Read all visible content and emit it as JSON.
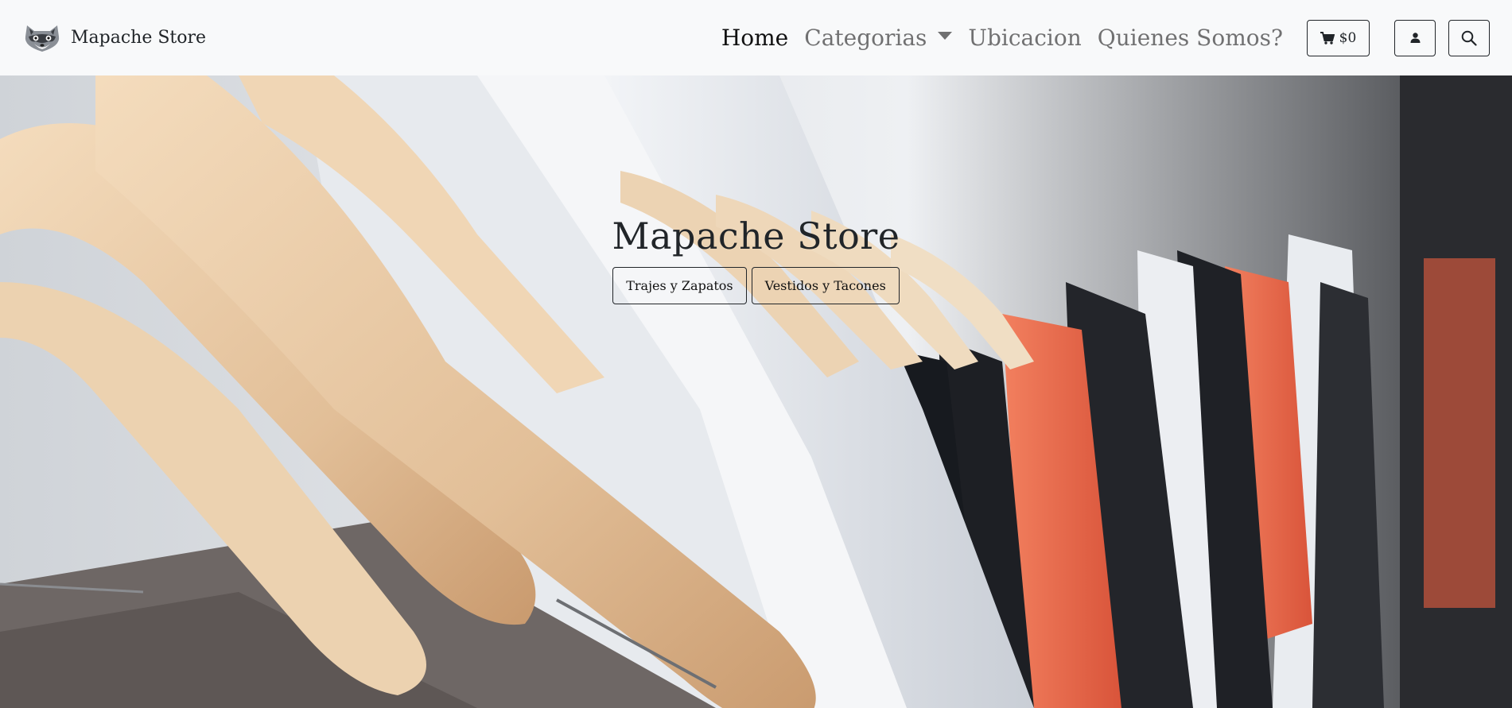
{
  "brand": {
    "name": "Mapache Store",
    "logo_icon": "raccoon-icon"
  },
  "nav": {
    "home": "Home",
    "categories": "Categorias",
    "location": "Ubicacion",
    "about": "Quienes Somos?"
  },
  "actions": {
    "cart_total": "$0",
    "cart_icon": "cart-icon",
    "user_icon": "user-icon",
    "search_icon": "search-icon"
  },
  "hero": {
    "title": "Mapache Store",
    "buttons": [
      "Trajes y Zapatos",
      "Vestidos y Tacones"
    ],
    "image_subject": "clothes hanging on wooden hangers"
  },
  "colors": {
    "navbar_bg": "#f8f9fa",
    "text_dark": "#212529",
    "nav_muted": "#6c6c6c",
    "shirt_white": "#e8ebef",
    "shirt_coral": "#ef6a4a",
    "shirt_black": "#1d1f24",
    "hanger_wood": "#e6c7a2"
  }
}
